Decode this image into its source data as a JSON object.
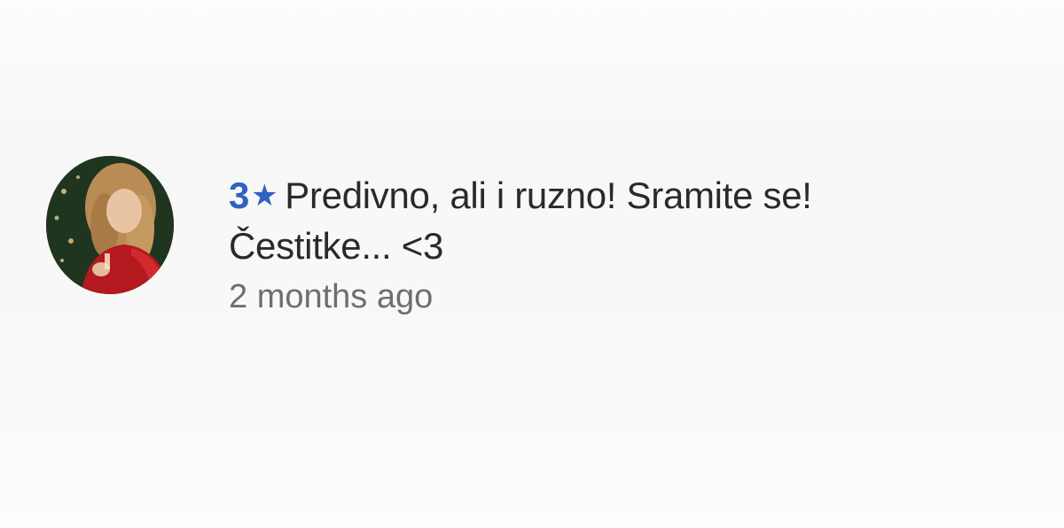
{
  "review": {
    "rating": "3",
    "star_icon": "★",
    "text_line1": "Predivno, ali i ruzno! Sramite se!",
    "text_line2": "Čestitke... <3",
    "timestamp": "2 months ago",
    "colors": {
      "rating": "#2f62c2",
      "text": "#2a2a2a",
      "timestamp": "#6e6e6e"
    }
  }
}
